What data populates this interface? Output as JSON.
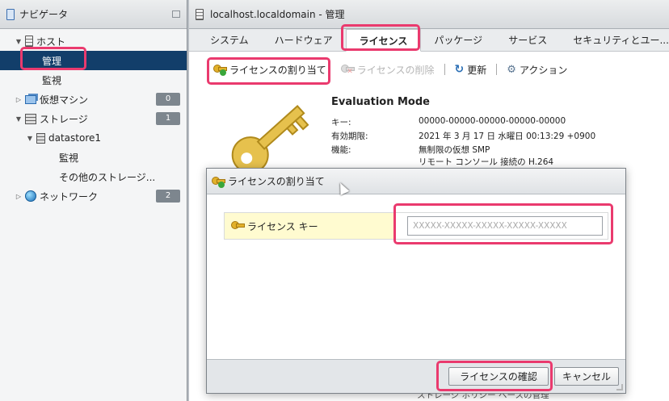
{
  "navigator": {
    "title": "ナビゲータ",
    "host": {
      "label": "ホスト",
      "children": [
        "管理",
        "監視"
      ]
    },
    "vms": {
      "label": "仮想マシン",
      "count": "0"
    },
    "storage": {
      "label": "ストレージ",
      "count": "1",
      "datastore": "datastore1",
      "children": [
        "監視",
        "その他のストレージ..."
      ]
    },
    "network": {
      "label": "ネットワーク",
      "count": "2"
    }
  },
  "main": {
    "title": "localhost.localdomain - 管理",
    "tabs": [
      "システム",
      "ハードウェア",
      "ライセンス",
      "パッケージ",
      "サービス",
      "セキュリティとユー..."
    ],
    "toolbar": {
      "assign": "ライセンスの割り当て",
      "remove": "ライセンスの削除",
      "refresh": "更新",
      "actions": "アクション"
    },
    "license": {
      "mode": "Evaluation Mode",
      "rows": [
        {
          "k": "キー:",
          "v": "00000-00000-00000-00000-00000"
        },
        {
          "k": "有効期限:",
          "v": "2021 年 3 月 17 日 水曜日 00:13:29 +0900"
        },
        {
          "k": "機能:",
          "v": "無制限の仮想 SMP"
        },
        {
          "k": "",
          "v": "リモート コンソール 接続の H.264"
        }
      ],
      "hidden_bottom": "ストレージ ポリシー ベースの管理"
    }
  },
  "dialog": {
    "title": "ライセンスの割り当て",
    "field_label": "ライセンス キー",
    "placeholder": "XXXXX-XXXXX-XXXXX-XXXXX-XXXXX",
    "confirm": "ライセンスの確認",
    "cancel": "キャンセル"
  },
  "colors": {
    "highlight": "#ea3a6e",
    "selected": "#123e6a"
  }
}
